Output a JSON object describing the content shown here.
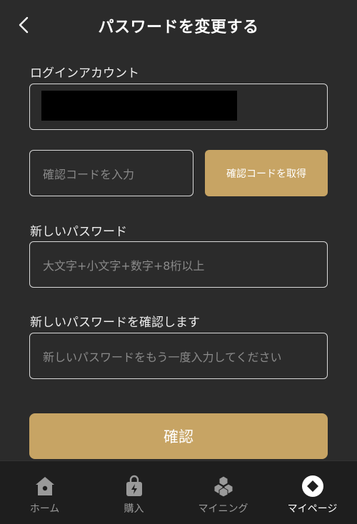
{
  "header": {
    "title": "パスワードを変更する",
    "back_icon": "chevron-left-icon"
  },
  "form": {
    "account_label": "ログインアカウント",
    "account_value_hidden": true,
    "code_placeholder": "確認コードを入力",
    "get_code_button": "確認コードを取得",
    "new_password_label": "新しいパスワード",
    "new_password_placeholder": "大文字+小文字+数字+8桁以上",
    "confirm_password_label": "新しいパスワードを確認します",
    "confirm_password_placeholder": "新しいパスワードをもう一度入力してください",
    "submit_button": "確認"
  },
  "tabbar": {
    "items": [
      {
        "label": "ホーム",
        "icon": "home-icon",
        "active": false
      },
      {
        "label": "購入",
        "icon": "shopping-bag-icon",
        "active": false
      },
      {
        "label": "マイニング",
        "icon": "cubes-icon",
        "active": false
      },
      {
        "label": "マイページ",
        "icon": "my-page-icon",
        "active": true
      }
    ]
  },
  "colors": {
    "background": "#2b2b2b",
    "accent": "#c7a464",
    "tabbar": "#1e1e1e",
    "border": "#d9d9d9"
  }
}
